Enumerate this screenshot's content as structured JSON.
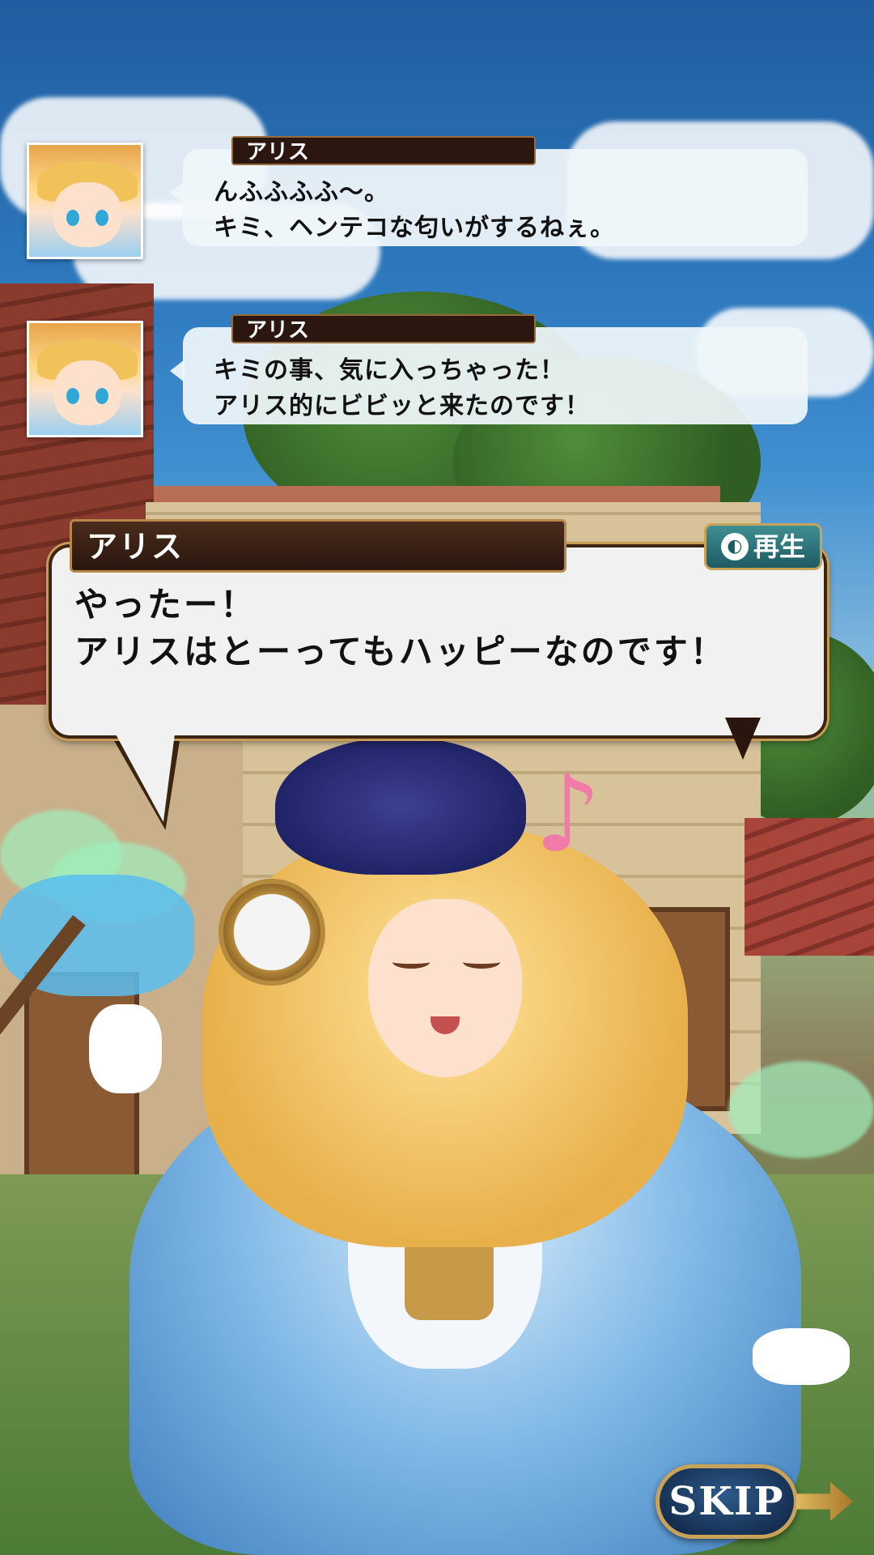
{
  "log": [
    {
      "speaker": "アリス",
      "line1": "んふふふふ〜。",
      "line2": "キミ、ヘンテコな匂いがするねぇ。"
    },
    {
      "speaker": "アリス",
      "line1": "キミの事、気に入っちゃった！",
      "line2": "アリス的にビビッと来たのです！"
    }
  ],
  "dialog": {
    "speaker": "アリス",
    "line1": "やったー！",
    "line2": "アリスはとーってもハッピーなのです！",
    "play_label": "再生",
    "play_icon": "speaker-play-icon"
  },
  "controls": {
    "skip_label": "SKIP"
  },
  "colors": {
    "name_plate": "#2b1710",
    "bubble": "#f1f1f1",
    "play_button": "#1e5a63",
    "skip_button": "#142c4e",
    "gold_trim": "#c9a25a"
  }
}
